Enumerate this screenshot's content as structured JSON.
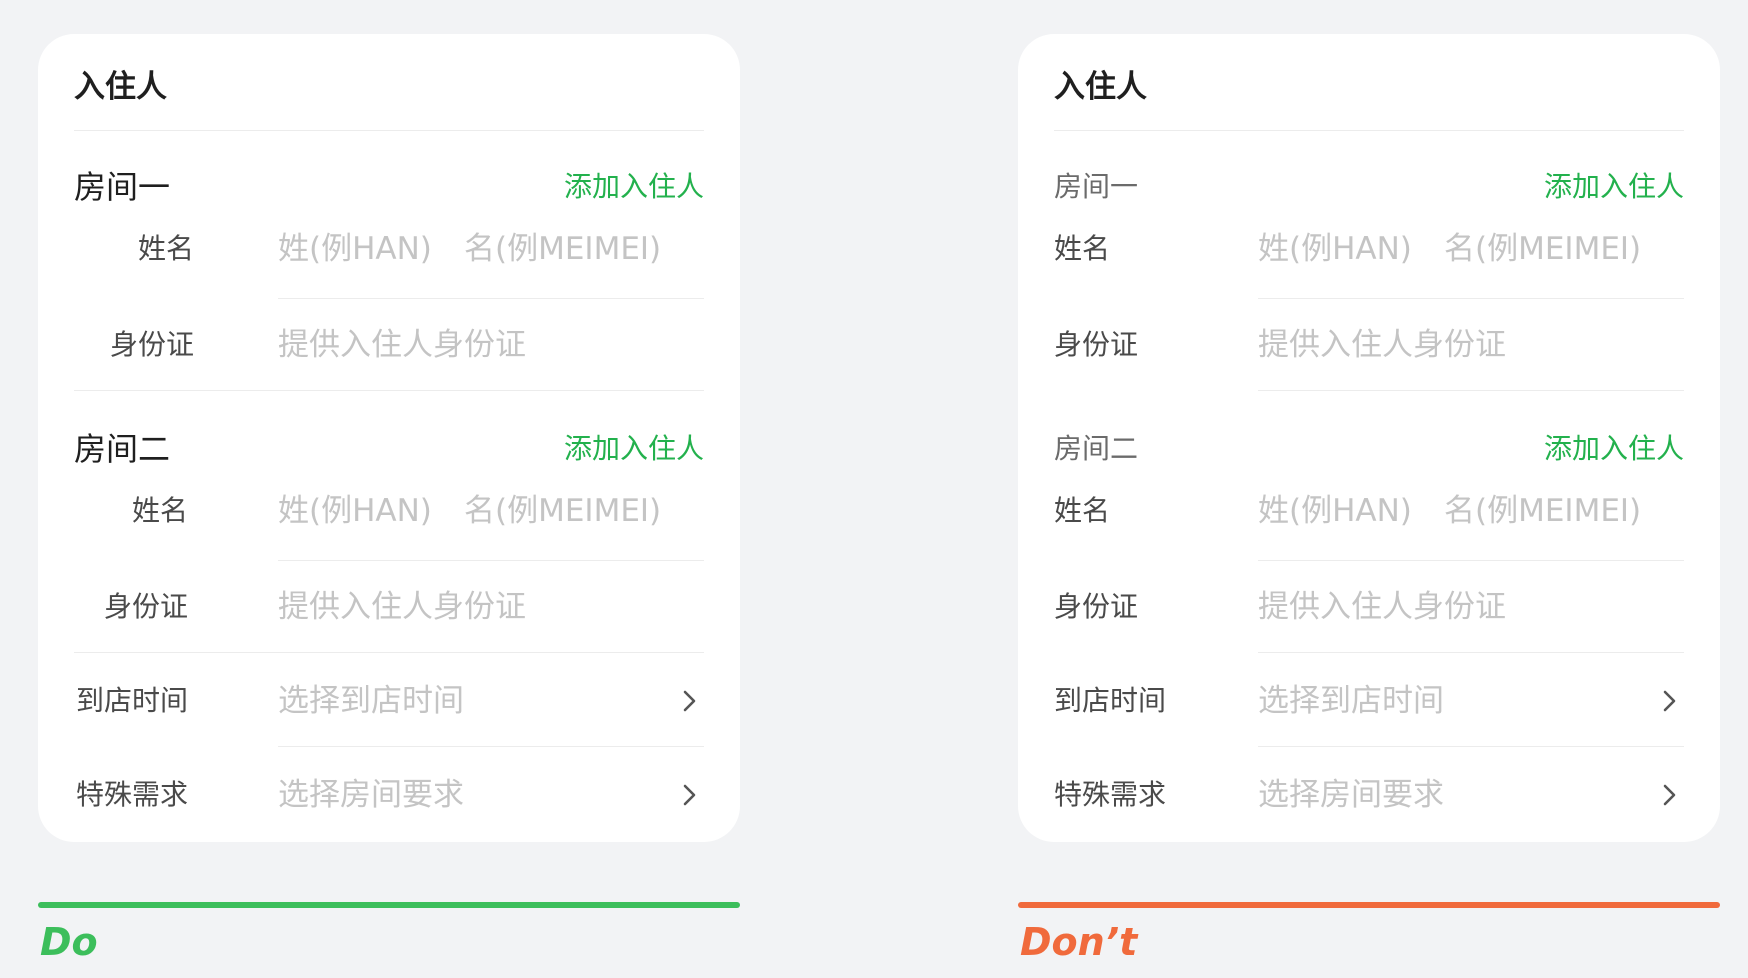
{
  "colors": {
    "background": "#f2f3f5",
    "card": "#ffffff",
    "accent_green": "#23b14d",
    "do_green": "#3cbe5b",
    "dont_orange": "#f06a3c",
    "placeholder": "#c4c4c4",
    "label": "#4a4a4a"
  },
  "cards": {
    "do": {
      "title": "入住人",
      "room1": {
        "title": "房间一",
        "add_label": "添加入住人",
        "name_label": "姓名",
        "surname_placeholder": "姓(例HAN)",
        "given_placeholder": "名(例MEIMEI)",
        "id_label": "身份证",
        "id_placeholder": "提供入住人身份证"
      },
      "room2": {
        "title": "房间二",
        "add_label": "添加入住人",
        "name_label": "姓名",
        "surname_placeholder": "姓(例HAN)",
        "given_placeholder": "名(例MEIMEI)",
        "id_label": "身份证",
        "id_placeholder": "提供入住人身份证"
      },
      "arrival": {
        "label": "到店时间",
        "placeholder": "选择到店时间",
        "icon": "chevron-right-icon"
      },
      "special": {
        "label": "特殊需求",
        "placeholder": "选择房间要求",
        "icon": "chevron-right-icon"
      }
    },
    "dont": {
      "title": "入住人",
      "room1": {
        "title": "房间一",
        "add_label": "添加入住人",
        "name_label": "姓名",
        "surname_placeholder": "姓(例HAN)",
        "given_placeholder": "名(例MEIMEI)",
        "id_label": "身份证",
        "id_placeholder": "提供入住人身份证"
      },
      "room2": {
        "title": "房间二",
        "add_label": "添加入住人",
        "name_label": "姓名",
        "surname_placeholder": "姓(例HAN)",
        "given_placeholder": "名(例MEIMEI)",
        "id_label": "身份证",
        "id_placeholder": "提供入住人身份证"
      },
      "arrival": {
        "label": "到店时间",
        "placeholder": "选择到店时间",
        "icon": "chevron-right-icon"
      },
      "special": {
        "label": "特殊需求",
        "placeholder": "选择房间要求",
        "icon": "chevron-right-icon"
      }
    }
  },
  "verdicts": {
    "do": "Do",
    "dont": "Don’t"
  }
}
